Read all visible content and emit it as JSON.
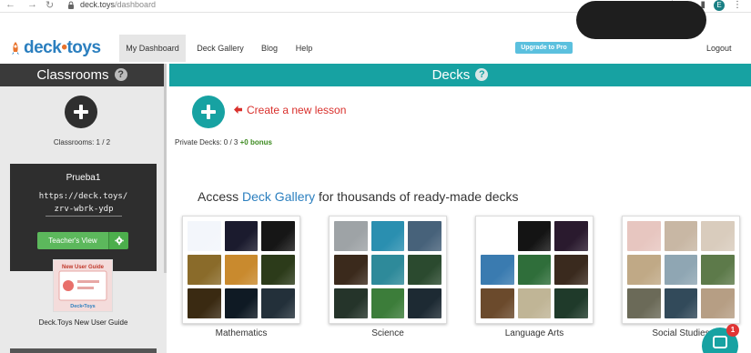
{
  "browser": {
    "url_host": "deck.toys",
    "url_path": "/dashboard",
    "profile_initial": "E",
    "google_badge": "G"
  },
  "brand": {
    "name_left": "deck",
    "name_dot": "•",
    "name_right": "toys",
    "accent": "#17a2a2"
  },
  "topnav": {
    "items": [
      {
        "label": "My Dashboard",
        "active": true
      },
      {
        "label": "Deck Gallery"
      },
      {
        "label": "Blog"
      },
      {
        "label": "Help"
      }
    ],
    "upgrade_label": "Upgrade to Pro",
    "logout_label": "Logout"
  },
  "sidebar": {
    "title": "Classrooms",
    "help": "?",
    "count_text": "Classrooms: 1 / 2",
    "classroom": {
      "name": "Prueba1",
      "url_line1": "https://deck.toys/",
      "url_line2": "zrv-wbrk-ydp",
      "teacher_view_label": "Teacher's View"
    },
    "guide": {
      "thumb_title": "New User Guide",
      "thumb_brand": "Deck•Toys",
      "label": "Deck.Toys New User Guide"
    }
  },
  "main": {
    "title": "Decks",
    "help": "?",
    "create_label": "Create a new lesson",
    "private_decks_label": "Private Decks: 0 / 3",
    "bonus_label": "+0 bonus",
    "gallery_prefix": "Access ",
    "gallery_link": "Deck Gallery",
    "gallery_suffix": " for thousands of ready-made decks",
    "decks": [
      {
        "label": "Mathematics",
        "tiles": [
          "#f3f6fb",
          "#1b1b2e",
          "#161616",
          "#8a6b2a",
          "#c98a2e",
          "#2c3b1a",
          "#3a2a12",
          "#0f1a24",
          "#23303a"
        ]
      },
      {
        "label": "Science",
        "tiles": [
          "#9ea3a6",
          "#2a8fb0",
          "#47627a",
          "#3b2a1c",
          "#2e8a9a",
          "#2b4a2f",
          "#25342a",
          "#3c7d3a",
          "#1d2a33"
        ]
      },
      {
        "label": "Language Arts",
        "tiles": [
          "#ffffff",
          "#141414",
          "#2a1a2e",
          "#3a7bb0",
          "#2f6e3a",
          "#3a2a1e",
          "#6b4a2c",
          "#c0b596",
          "#1f3a2a"
        ]
      },
      {
        "label": "Social Studies",
        "tiles": [
          "#e7c6c0",
          "#c8b7a4",
          "#d9ccbd",
          "#c0a986",
          "#8fa6b3",
          "#5d7a4a",
          "#6b6a58",
          "#324a5a",
          "#b69e84"
        ]
      }
    ]
  },
  "chat": {
    "badge": "1"
  }
}
